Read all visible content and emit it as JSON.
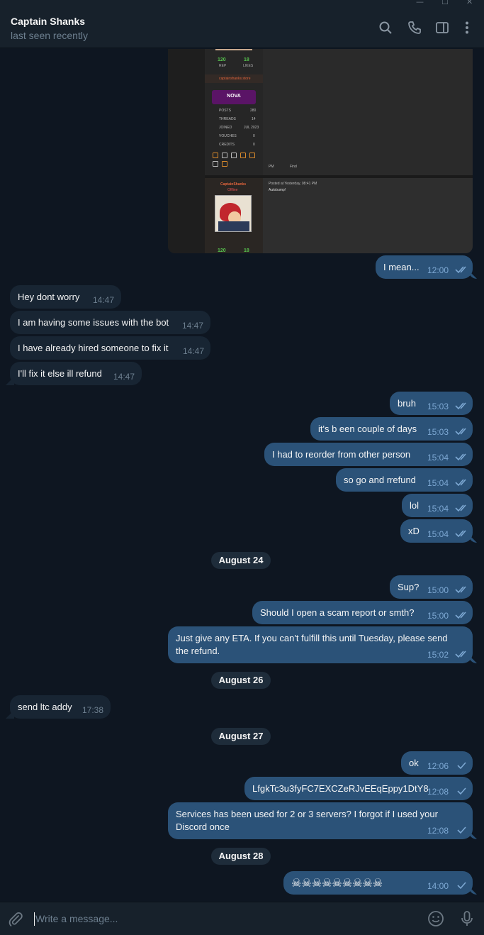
{
  "window": {
    "minimize_glyph": "—",
    "maximize_glyph": "☐",
    "close_glyph": "✕"
  },
  "header": {
    "name": "Captain Shanks",
    "status": "last seen recently",
    "icons": [
      "search-icon",
      "phone-icon",
      "sidebar-icon",
      "more-icon"
    ]
  },
  "photo": {
    "stats1": [
      "120",
      "18"
    ],
    "stats1_labels": [
      "REP",
      "LIKES"
    ],
    "site": "captainshanks.store",
    "badge": "NOVA",
    "rows": [
      {
        "label": "POSTS",
        "value": "280"
      },
      {
        "label": "THREADS",
        "value": "14"
      },
      {
        "label": "JOINED",
        "value": "JUL 2023"
      },
      {
        "label": "VOUCHES",
        "value": "0"
      },
      {
        "label": "CREDITS",
        "value": "0"
      }
    ],
    "pm": "PM",
    "find": "Find",
    "user": "CaptainShanks",
    "offline": "Offline",
    "posted": "Posted at Yesterday, 08:41 PM",
    "post": "Autobump!",
    "stats2": [
      "120",
      "18"
    ]
  },
  "messages": [
    {
      "text": "I mean...",
      "time": "12:00"
    },
    {
      "text": "Hey dont worry",
      "time": "14:47"
    },
    {
      "text": "I am having some issues with the bot",
      "time": "14:47"
    },
    {
      "text": "I have already hired someone to fix it",
      "time": "14:47"
    },
    {
      "text": "I'll fix it else ill refund",
      "time": "14:47"
    },
    {
      "text": "bruh",
      "time": "15:03"
    },
    {
      "text": "it's b een couple of days",
      "time": "15:03"
    },
    {
      "text": "I had to reorder from other person",
      "time": "15:04"
    },
    {
      "text": "so go and rrefund",
      "time": "15:04"
    },
    {
      "text": "lol",
      "time": "15:04"
    },
    {
      "text": "xD",
      "time": "15:04"
    },
    {
      "text": "Sup?",
      "time": "15:00"
    },
    {
      "text": "Should I open a scam report or smth?",
      "time": "15:00"
    },
    {
      "text": "Just give any ETA. If you can't fulfill this until Tuesday, please send the refund.",
      "time": "15:02"
    },
    {
      "text": "send ltc addy",
      "time": "17:38"
    },
    {
      "text": "ok",
      "time": "12:06"
    },
    {
      "text": "LfgkTc3u3fyFC7EXCZeRJvEEqEppy1DtY8",
      "time": "12:08"
    },
    {
      "text": "Services has been used for 2 or 3 servers? I forgot if I used your Discord once",
      "time": "12:08"
    },
    {
      "text": "☠☠☠☠☠☠☠☠☠",
      "time": "14:00"
    }
  ],
  "dates": [
    "August 24",
    "August 26",
    "August 27",
    "August 28"
  ],
  "composer": {
    "placeholder": "Write a message...",
    "icons": [
      "paperclip-icon",
      "emoji-icon",
      "microphone-icon"
    ]
  },
  "colors": {
    "background": "#0e1621",
    "header": "#17212b",
    "outgoing": "#2b5278",
    "incoming": "#182533",
    "accent": "#7da8d3"
  }
}
